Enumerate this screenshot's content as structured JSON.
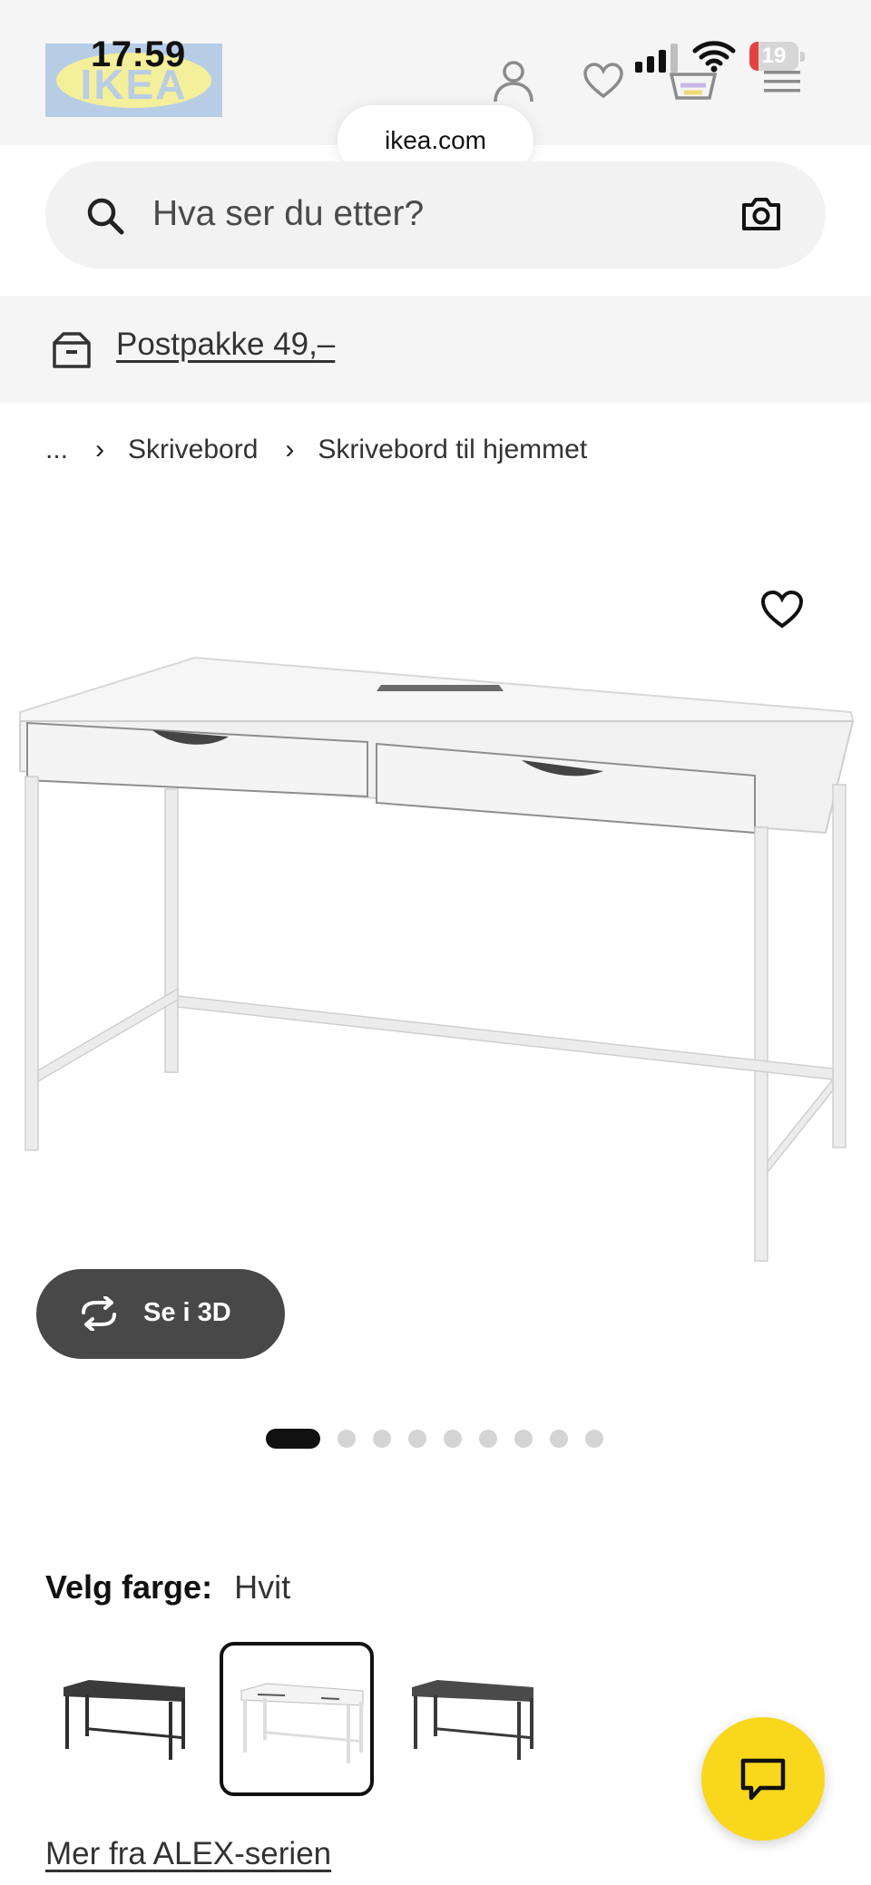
{
  "status_bar": {
    "time": "17:59",
    "battery_level": "19",
    "battery_percent": 19,
    "battery_color": "#e5423f"
  },
  "header": {
    "logo_text": "IKEA",
    "icons": [
      "user-icon",
      "heart-icon",
      "basket-icon",
      "menu-icon"
    ],
    "url": "ikea.com"
  },
  "search": {
    "placeholder": "Hva ser du etter?",
    "left_icon": "search-icon",
    "right_icon": "camera-icon"
  },
  "delivery": {
    "icon": "package-box-icon",
    "label": "Postpakke 49,–"
  },
  "breadcrumb": {
    "ellipsis": "...",
    "items": [
      "Skrivebord",
      "Skrivebord til hjemmet"
    ],
    "separator": "›"
  },
  "product": {
    "favorite_icon": "heart-icon",
    "view_3d_label": "Se i 3D",
    "view_3d_icon": "rotate-icon",
    "carousel": {
      "total": 9,
      "active": 1
    }
  },
  "color_picker": {
    "label": "Velg farge:",
    "selected": "Hvit",
    "swatches": [
      {
        "color": "#3a3a3a",
        "selected": false
      },
      {
        "color": "#f2f2f2",
        "selected": true
      },
      {
        "color": "#4a4a4a",
        "selected": false
      }
    ]
  },
  "series_link": "Mer fra ALEX-serien",
  "chat": {
    "icon": "chat-icon",
    "color": "#f9d71c"
  },
  "colors": {
    "brand_yellow": "#f9d71c",
    "dark_button": "#484848",
    "header_bg": "#f5f5f5"
  }
}
